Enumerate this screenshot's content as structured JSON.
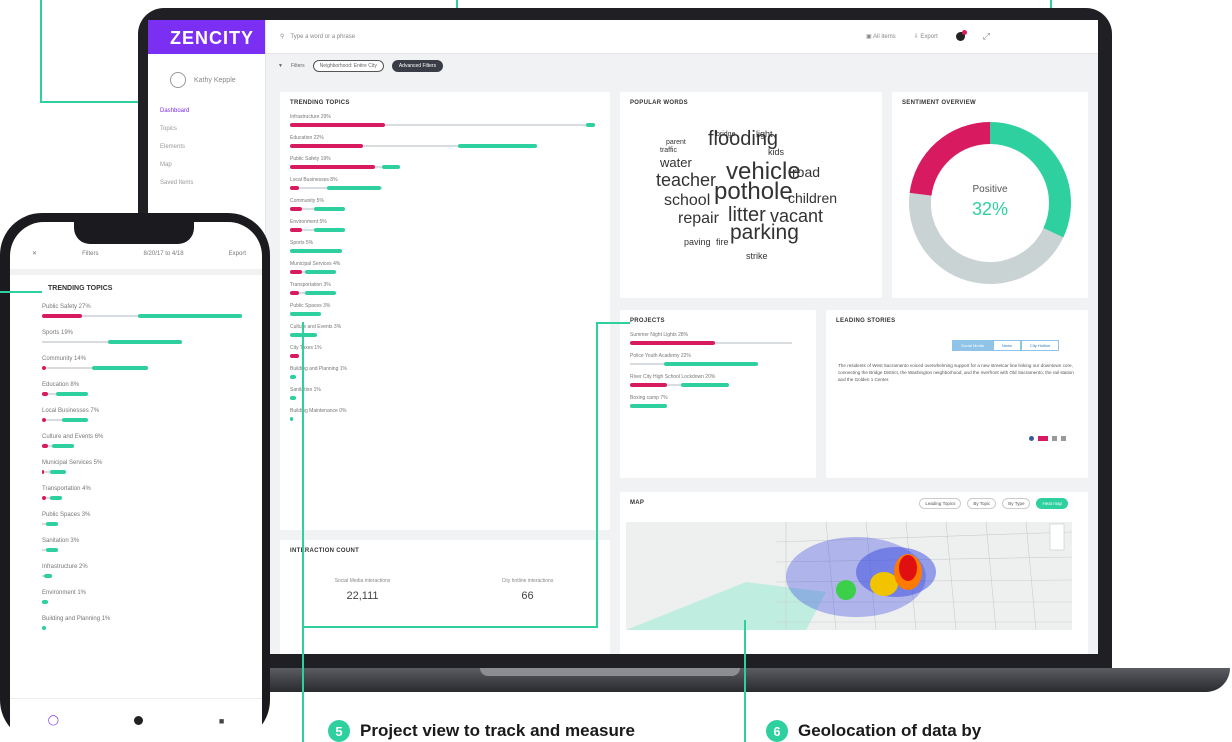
{
  "app": {
    "brand": "ZENCITY",
    "user_name": "Kathy Kepple"
  },
  "sidebar": {
    "items": [
      {
        "label": "Dashboard",
        "active": true
      },
      {
        "label": "Topics",
        "active": false
      },
      {
        "label": "Elements",
        "active": false
      },
      {
        "label": "Map",
        "active": false
      },
      {
        "label": "Saved Items",
        "active": false
      }
    ]
  },
  "topbar": {
    "search_placeholder": "Type a word or a phrase",
    "all_items": "All items",
    "export": "Export"
  },
  "filters": {
    "label": "Filters",
    "neighborhood_chip": "Neighborhood: Entire City",
    "advanced_chip": "Advanced Filters"
  },
  "trending": {
    "title": "TRENDING TOPICS",
    "topics": [
      {
        "label": "Infrastructure 29%",
        "pink": 0.31,
        "green_start": 0.97,
        "green": 0.03
      },
      {
        "label": "Education 22%",
        "pink": 0.24,
        "green_start": 0.55,
        "green": 0.26
      },
      {
        "label": "Public Safety 19%",
        "pink": 0.28,
        "green_start": 0.3,
        "green": 0.06
      },
      {
        "label": "Local Businesses 8%",
        "pink": 0.03,
        "green_start": 0.12,
        "green": 0.18
      },
      {
        "label": "Community 5%",
        "pink": 0.04,
        "green_start": 0.08,
        "green": 0.1
      },
      {
        "label": "Environment 5%",
        "pink": 0.04,
        "green_start": 0.08,
        "green": 0.1
      },
      {
        "label": "Sports 5%",
        "pink": 0.0,
        "green_start": 0.0,
        "green": 0.17
      },
      {
        "label": "Municipal Services 4%",
        "pink": 0.04,
        "green_start": 0.05,
        "green": 0.1
      },
      {
        "label": "Transportation 3%",
        "pink": 0.03,
        "green_start": 0.05,
        "green": 0.1
      },
      {
        "label": "Public Spaces 3%",
        "pink": 0.0,
        "green_start": 0.0,
        "green": 0.1
      },
      {
        "label": "Culture and Events 3%",
        "pink": 0.0,
        "green_start": 0.0,
        "green": 0.09
      },
      {
        "label": "City Taxes 1%",
        "pink": 0.03,
        "green_start": 0.0,
        "green": 0.0
      },
      {
        "label": "Building and Planning 1%",
        "pink": 0.0,
        "green_start": 0.0,
        "green": 0.02
      },
      {
        "label": "Sanitation 1%",
        "pink": 0.0,
        "green_start": 0.0,
        "green": 0.02
      },
      {
        "label": "Building Maintenance 0%",
        "pink": 0.0,
        "green_start": 0.0,
        "green": 0.01
      }
    ]
  },
  "interaction": {
    "title": "INTERACTION COUNT",
    "social_label": "Social Media interactions",
    "social_value": "22,111",
    "hotline_label": "City hotline interactions",
    "hotline_value": "66"
  },
  "popular_words": {
    "title": "POPULAR WORDS",
    "words": [
      "flooding",
      "water",
      "teacher",
      "vehicle",
      "road",
      "school",
      "pothole",
      "children",
      "repair",
      "litter",
      "vacant",
      "paving",
      "fire",
      "parking",
      "strike",
      "kids",
      "light",
      "bridge",
      "traffic",
      "parent"
    ]
  },
  "sentiment": {
    "title": "SENTIMENT OVERVIEW",
    "label": "Positive",
    "value": "32%",
    "segments": [
      {
        "name": "positive",
        "share": 0.32,
        "color": "#2fd0a0"
      },
      {
        "name": "neutral",
        "share": 0.45,
        "color": "#c9d3d3"
      },
      {
        "name": "negative",
        "share": 0.23,
        "color": "#d81b60"
      }
    ]
  },
  "projects": {
    "title": "PROJECTS",
    "items": [
      {
        "label": "Summer Night Lights 28%",
        "pink": 0.5,
        "green_start": 0.0,
        "green": 0.0,
        "grey": 0.95
      },
      {
        "label": "Police Youth Academy 22%",
        "pink": 0.0,
        "green_start": 0.2,
        "green": 0.55
      },
      {
        "label": "River City High School Lockdown 20%",
        "pink": 0.22,
        "green_start": 0.3,
        "green": 0.28
      },
      {
        "label": "Boxing camp 7%",
        "pink": 0.0,
        "green_start": 0.0,
        "green": 0.22
      }
    ]
  },
  "leading_stories": {
    "title": "LEADING STORIES",
    "tabs": [
      "Social Media",
      "News",
      "City Hotline"
    ],
    "story": "The residents of West Sacramento voiced overwhelming support for a new streetcar line linking our downtown core, connecting the Bridge District, the Washington neighborhood, and the riverfront with Old Sacramento, the rail station and the Golden 1 Center."
  },
  "map": {
    "title": "MAP",
    "controls": [
      "Leading Topics",
      "By Topic",
      "By Type",
      "Heat map"
    ]
  },
  "phone": {
    "header_filters": "Filters",
    "header_dates": "8/20/17 to 4/18",
    "header_export": "Export",
    "title": "TRENDING TOPICS",
    "topics": [
      {
        "label": "Public Safety 27%",
        "pink": 0.2,
        "green_start": 0.48,
        "green": 0.52
      },
      {
        "label": "Sports 19%",
        "pink": 0.0,
        "green_start": 0.33,
        "green": 0.37
      },
      {
        "label": "Community 14%",
        "pink": 0.02,
        "green_start": 0.25,
        "green": 0.28
      },
      {
        "label": "Education 8%",
        "pink": 0.03,
        "green_start": 0.07,
        "green": 0.16
      },
      {
        "label": "Local Businesses 7%",
        "pink": 0.02,
        "green_start": 0.1,
        "green": 0.13
      },
      {
        "label": "Culture and Events 6%",
        "pink": 0.03,
        "green_start": 0.05,
        "green": 0.11
      },
      {
        "label": "Municipal Services 5%",
        "pink": 0.01,
        "green_start": 0.04,
        "green": 0.08
      },
      {
        "label": "Transportation 4%",
        "pink": 0.02,
        "green_start": 0.04,
        "green": 0.06
      },
      {
        "label": "Public Spaces 3%",
        "pink": 0.0,
        "green_start": 0.02,
        "green": 0.06
      },
      {
        "label": "Sanitation 3%",
        "pink": 0.0,
        "green_start": 0.02,
        "green": 0.06
      },
      {
        "label": "Infrastructure 2%",
        "pink": 0.0,
        "green_start": 0.01,
        "green": 0.04
      },
      {
        "label": "Environment 1%",
        "pink": 0.0,
        "green_start": 0.0,
        "green": 0.03
      },
      {
        "label": "Building and Planning 1%",
        "pink": 0.0,
        "green_start": 0.0,
        "green": 0.02
      }
    ]
  },
  "captions": [
    {
      "num": "5",
      "text": "Project view to track and measure"
    },
    {
      "num": "6",
      "text": "Geolocation of data by"
    }
  ],
  "colors": {
    "brand": "#7b2ff2",
    "accent": "#2fd0a0",
    "negative": "#d81b60",
    "neutral": "#c9d3d3"
  }
}
